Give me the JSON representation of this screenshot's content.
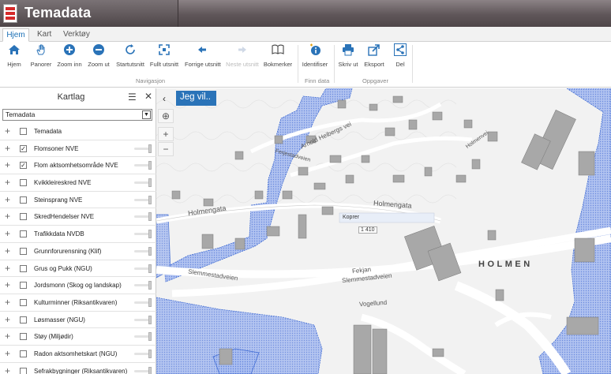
{
  "app": {
    "title": "Temadata"
  },
  "tabs": [
    {
      "label": "Hjem",
      "active": true
    },
    {
      "label": "Kart",
      "active": false
    },
    {
      "label": "Verktøy",
      "active": false
    }
  ],
  "ribbon": {
    "navigation": {
      "group_label": "Navigasjon",
      "buttons": [
        {
          "label": "Hjem",
          "icon": "home-icon"
        },
        {
          "label": "Panorer",
          "icon": "hand-icon"
        },
        {
          "label": "Zoom inn",
          "icon": "zoom-in-icon"
        },
        {
          "label": "Zoom ut",
          "icon": "zoom-out-icon"
        },
        {
          "label": "Startutsnitt",
          "icon": "refresh-icon"
        },
        {
          "label": "Fullt utsnitt",
          "icon": "fullscreen-icon"
        },
        {
          "label": "Forrige utsnitt",
          "icon": "arrow-left-icon"
        },
        {
          "label": "Neste utsnitt",
          "icon": "arrow-right-icon",
          "disabled": true
        },
        {
          "label": "Bokmerker",
          "icon": "book-icon"
        }
      ]
    },
    "find_data": {
      "group_label": "Finn data",
      "buttons": [
        {
          "label": "Identifiser",
          "icon": "info-icon"
        }
      ]
    },
    "tasks": {
      "group_label": "Oppgaver",
      "buttons": [
        {
          "label": "Skriv ut",
          "icon": "printer-icon"
        },
        {
          "label": "Eksport",
          "icon": "export-icon"
        },
        {
          "label": "Del",
          "icon": "share-icon"
        }
      ]
    }
  },
  "layer_panel": {
    "title": "Kartlag",
    "select_value": "Temadata",
    "layers": [
      {
        "name": "Temadata",
        "checked": false,
        "slider": false
      },
      {
        "name": "Flomsoner NVE",
        "checked": true,
        "slider": true
      },
      {
        "name": "Flom aktsomhetsområde NVE",
        "checked": true,
        "slider": true
      },
      {
        "name": "Kvikkleireskred NVE",
        "checked": false,
        "slider": true
      },
      {
        "name": "Steinsprang NVE",
        "checked": false,
        "slider": true
      },
      {
        "name": "SkredHendelser NVE",
        "checked": false,
        "slider": true
      },
      {
        "name": "Trafikkdata NVDB",
        "checked": false,
        "slider": true
      },
      {
        "name": "Grunnforurensning (Klif)",
        "checked": false,
        "slider": true
      },
      {
        "name": "Grus og Pukk (NGU)",
        "checked": false,
        "slider": true
      },
      {
        "name": "Jordsmonn (Skog og landskap)",
        "checked": false,
        "slider": true
      },
      {
        "name": "Kulturminner (Riksantikvaren)",
        "checked": false,
        "slider": true
      },
      {
        "name": "Løsmasser (NGU)",
        "checked": false,
        "slider": true
      },
      {
        "name": "Støy (Miljødir)",
        "checked": false,
        "slider": true
      },
      {
        "name": "Radon aktsomhetskart (NGU)",
        "checked": false,
        "slider": true
      },
      {
        "name": "Sefrakbygninger (Riksantikvaren)",
        "checked": false,
        "slider": true
      }
    ]
  },
  "map": {
    "action_button": "Jeg vil..",
    "place_label": "HOLMEN",
    "road_labels": [
      "Holmengata",
      "Holmengata",
      "Slemmestadveien",
      "Slemmestadveien",
      "Fekjan",
      "Vogellund",
      "Arnold Heibergs vei",
      "Ferjestadveien",
      "Holmenvei"
    ],
    "popup_labels": [
      "Koprer",
      "1 410"
    ],
    "flood_color": "#7ea0e6",
    "flood_border": "#2f5fd0"
  }
}
